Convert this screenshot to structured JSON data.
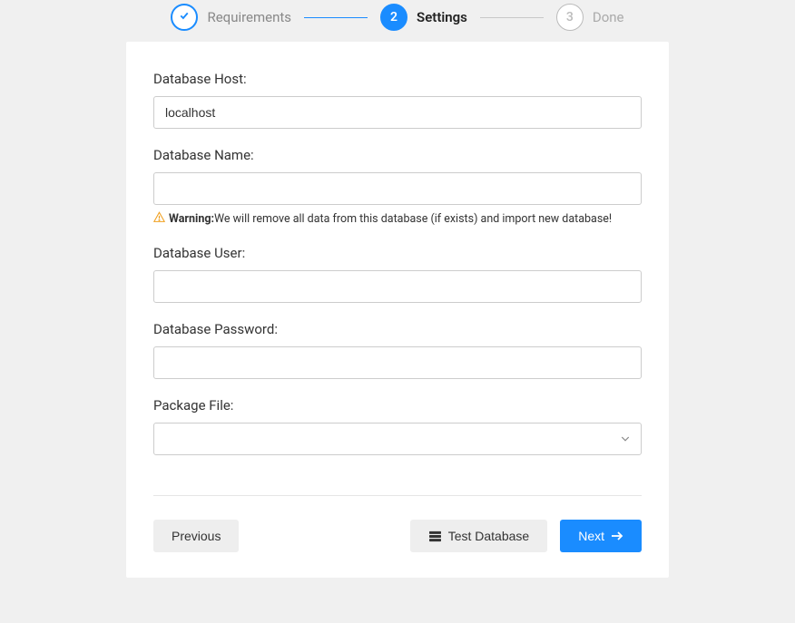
{
  "stepper": {
    "steps": [
      {
        "label": "Requirements",
        "state": "completed"
      },
      {
        "num": "2",
        "label": "Settings",
        "state": "active"
      },
      {
        "num": "3",
        "label": "Done",
        "state": "pending"
      }
    ]
  },
  "form": {
    "db_host": {
      "label": "Database Host:",
      "value": "localhost"
    },
    "db_name": {
      "label": "Database Name:",
      "value": "",
      "warning_label": "Warning:",
      "warning_message": "We will remove all data from this database (if exists) and import new database!"
    },
    "db_user": {
      "label": "Database User:",
      "value": ""
    },
    "db_password": {
      "label": "Database Password:",
      "value": ""
    },
    "package_file": {
      "label": "Package File:",
      "selected": ""
    }
  },
  "buttons": {
    "previous": "Previous",
    "test_database": "Test Database",
    "next": "Next"
  }
}
